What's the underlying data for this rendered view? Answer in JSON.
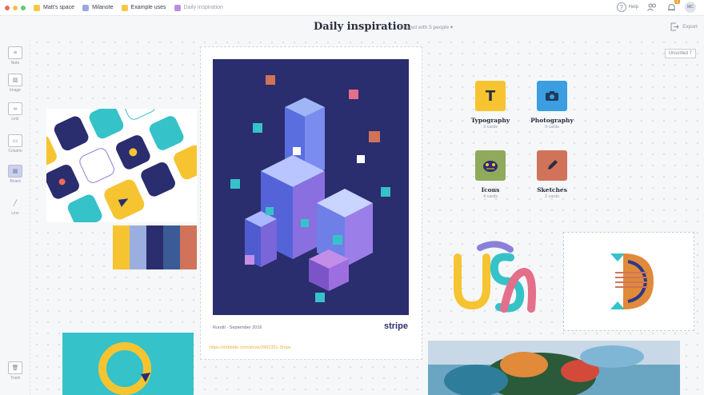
{
  "topbar": {
    "traffic_colors": [
      "#f26b5a",
      "#f5bd4f",
      "#5fcf6b"
    ],
    "breadcrumbs": [
      {
        "label": "Matt's space",
        "color": "#f5c842"
      },
      {
        "label": "Milanote",
        "color": "#9aa8e0"
      },
      {
        "label": "Example uses",
        "color": "#f5c842"
      },
      {
        "label": "Daily inspiration",
        "color": "#b88ee0"
      }
    ],
    "help_label": "Help",
    "notifications_count": "1",
    "avatar_initials": "MC"
  },
  "board": {
    "title": "Daily inspiration",
    "shared_label": "Shared with 5 people",
    "export_label": "Export",
    "unsorted_label": "Unsorted",
    "unsorted_count": "7"
  },
  "sidebar": {
    "tools": [
      {
        "label": "Note"
      },
      {
        "label": "Image"
      },
      {
        "label": "Link"
      },
      {
        "label": "Column"
      },
      {
        "label": "Board"
      },
      {
        "label": "Line"
      },
      {
        "label": "Trash"
      }
    ]
  },
  "poster": {
    "caption": "Rundit  ·  September 2016",
    "brand": "stripe"
  },
  "link_card": {
    "url": "https://dribbble.com/shots/2862351-Stripe"
  },
  "categories": [
    {
      "name": "Typography",
      "count": "3 cards",
      "color": "#f6c431",
      "icon": "T"
    },
    {
      "name": "Photography",
      "count": "9 cards",
      "color": "#3a9ee0",
      "icon": "camera"
    },
    {
      "name": "Icons",
      "count": "4 cards",
      "color": "#8faa5a",
      "icon": "monster"
    },
    {
      "name": "Sketches",
      "count": "2 cards",
      "color": "#d0735a",
      "icon": "pencil"
    }
  ],
  "swatches": [
    "#f6c431",
    "#9aaee0",
    "#2a2d6e",
    "#3b5b96",
    "#d0735a"
  ]
}
